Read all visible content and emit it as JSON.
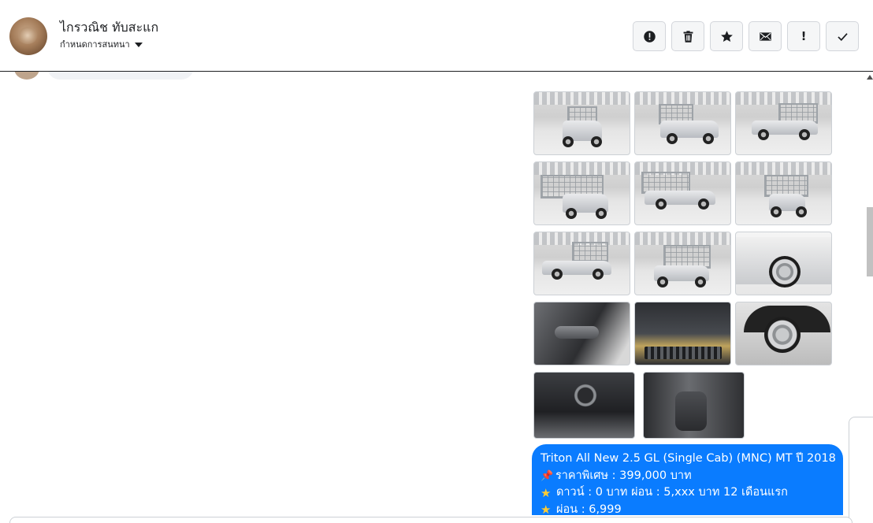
{
  "header": {
    "name": "ไกรวณิช ทับสะแก",
    "status_label": "กำหนดการสนทนา"
  },
  "actions": [
    {
      "name": "alert-circle-icon",
      "glyph": "!"
    },
    {
      "name": "trash-icon",
      "glyph": ""
    },
    {
      "name": "star-icon",
      "glyph": ""
    },
    {
      "name": "mail-icon",
      "glyph": ""
    },
    {
      "name": "exclamation-icon",
      "glyph": "!"
    },
    {
      "name": "check-icon",
      "glyph": ""
    }
  ],
  "message": {
    "line1": "Triton All New 2.5 GL (Single Cab) (MNC) MT ปี 2018",
    "line2": "ราคาพิเศษ : 399,000 บาท",
    "line3": "ดาวน์ : 0 บาท ผ่อน : 5,xxx บาท 12 เดือนแรก",
    "line4": "ผ่อน : 6,999"
  }
}
